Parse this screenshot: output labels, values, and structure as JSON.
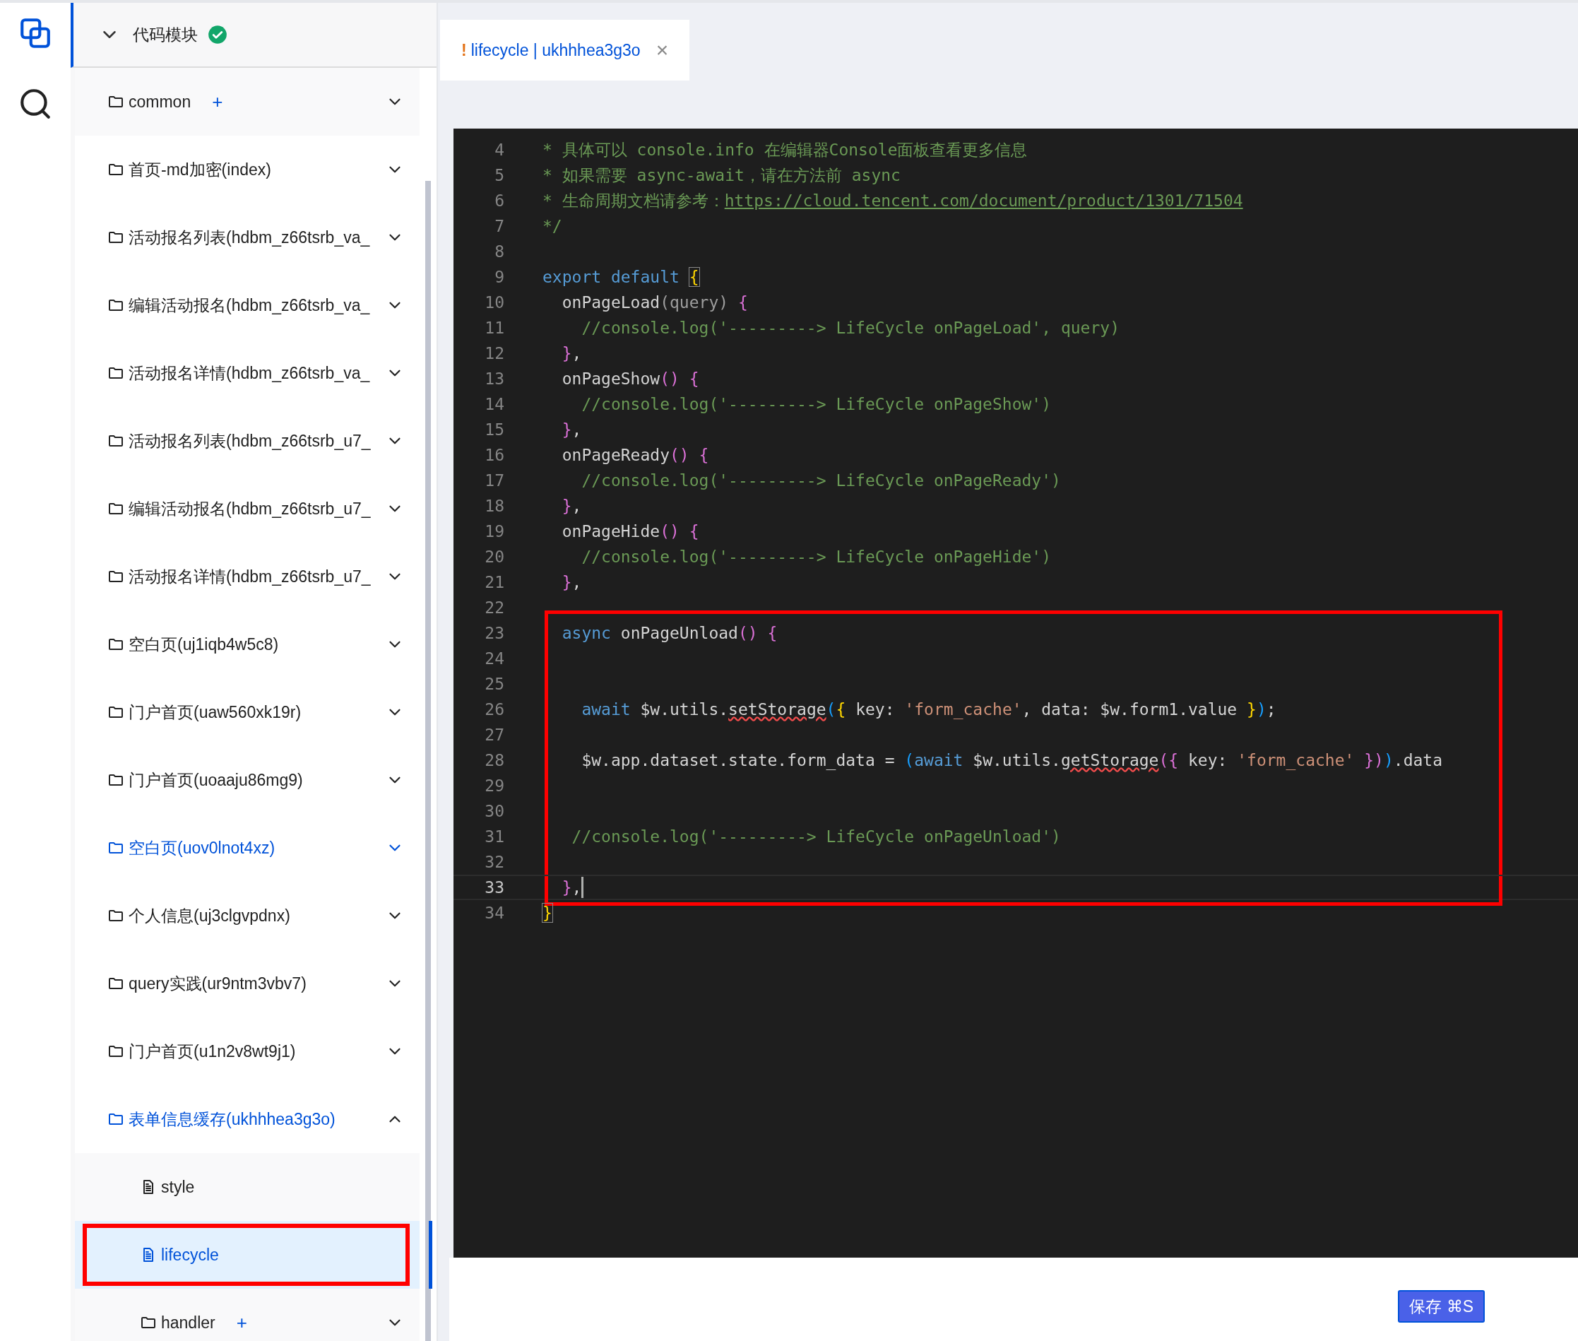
{
  "activity_bar": {
    "items": [
      {
        "kind": "pages",
        "selected": true
      },
      {
        "kind": "search",
        "selected": false
      }
    ]
  },
  "tree": {
    "label": "代码模块",
    "expanded": true,
    "status_ok": true,
    "children": [
      {
        "kind": "folder",
        "label": "common",
        "add": "+",
        "expanded": false,
        "selected": false,
        "shaded": true
      },
      {
        "kind": "folder",
        "label": "首页-md加密(index)",
        "expanded": false,
        "selected": false
      },
      {
        "kind": "folder",
        "label": "活动报名列表(hdbm_z66tsrb_va_",
        "expanded": false,
        "selected": false
      },
      {
        "kind": "folder",
        "label": "编辑活动报名(hdbm_z66tsrb_va_",
        "expanded": false,
        "selected": false
      },
      {
        "kind": "folder",
        "label": "活动报名详情(hdbm_z66tsrb_va_",
        "expanded": false,
        "selected": false
      },
      {
        "kind": "folder",
        "label": "活动报名列表(hdbm_z66tsrb_u7_",
        "expanded": false,
        "selected": false
      },
      {
        "kind": "folder",
        "label": "编辑活动报名(hdbm_z66tsrb_u7_",
        "expanded": false,
        "selected": false
      },
      {
        "kind": "folder",
        "label": "活动报名详情(hdbm_z66tsrb_u7_",
        "expanded": false,
        "selected": false
      },
      {
        "kind": "folder",
        "label": "空白页(uj1iqb4w5c8)",
        "expanded": false,
        "selected": false
      },
      {
        "kind": "folder",
        "label": "门户首页(uaw560xk19r)",
        "expanded": false,
        "selected": false
      },
      {
        "kind": "folder",
        "label": "门户首页(uoaaju86mg9)",
        "expanded": false,
        "selected": false
      },
      {
        "kind": "folder",
        "label": "空白页(uov0lnot4xz)",
        "expanded": false,
        "selected": true
      },
      {
        "kind": "folder",
        "label": "个人信息(uj3clgvpdnx)",
        "expanded": false,
        "selected": false
      },
      {
        "kind": "folder",
        "label": "query实践(ur9ntm3vbv7)",
        "expanded": false,
        "selected": false
      },
      {
        "kind": "folder",
        "label": "门户首页(u1n2v8wt9j1)",
        "expanded": false,
        "selected": false
      },
      {
        "kind": "folder",
        "label": "表单信息缓存(ukhhhea3g3o)",
        "expanded": true,
        "selected": true,
        "children": [
          {
            "kind": "file",
            "label": "style",
            "selected": false,
            "annotated": false
          },
          {
            "kind": "file",
            "label": "lifecycle",
            "selected": true,
            "annotated": true
          },
          {
            "kind": "folder",
            "label": "handler",
            "add": "+",
            "expanded": false,
            "selected": false
          }
        ]
      }
    ]
  },
  "tabs": [
    {
      "warning": "!",
      "label": "lifecycle | ukhhhea3g3o",
      "close": "×",
      "selected": true
    }
  ],
  "editor": {
    "lines": [
      {
        "number": "4",
        "current": false,
        "boxed": false,
        "tokens": [
          {
            "kind": "comment",
            "text": "* 具体可以 console.info 在编辑器Console面板查看更多信息"
          }
        ]
      },
      {
        "number": "5",
        "current": false,
        "boxed": false,
        "tokens": [
          {
            "kind": "comment",
            "text": "* 如果需要 async-await，请在方法前 async"
          }
        ]
      },
      {
        "number": "6",
        "current": false,
        "boxed": false,
        "tokens": [
          {
            "kind": "comment",
            "text": "* 生命周期文档请参考："
          },
          {
            "kind": "link",
            "text": "https://cloud.tencent.com/document/product/1301/71504"
          }
        ]
      },
      {
        "number": "7",
        "current": false,
        "boxed": false,
        "tokens": [
          {
            "kind": "comment",
            "text": "*/"
          }
        ]
      },
      {
        "number": "8",
        "current": false,
        "boxed": false
      },
      {
        "number": "9",
        "current": false,
        "boxed": false,
        "tokens": [
          {
            "kind": "keyword",
            "text": "export default "
          },
          {
            "kind": "brace_match",
            "text": "{"
          }
        ]
      },
      {
        "number": "10",
        "current": false,
        "boxed": false,
        "tokens": [
          {
            "kind": "plain",
            "text": "  onPageLoad"
          },
          {
            "kind": "dim",
            "text": "(query)"
          },
          {
            "kind": "pink",
            "text": " {"
          }
        ]
      },
      {
        "number": "11",
        "current": false,
        "boxed": false,
        "tokens": [
          {
            "kind": "comment",
            "text": "    //console.log('---------> LifeCycle onPageLoad', query)"
          }
        ]
      },
      {
        "number": "12",
        "current": false,
        "boxed": false,
        "tokens": [
          {
            "kind": "pink",
            "text": "  }"
          },
          {
            "kind": "plain",
            "text": ","
          }
        ]
      },
      {
        "number": "13",
        "current": false,
        "boxed": false,
        "tokens": [
          {
            "kind": "plain",
            "text": "  onPageShow"
          },
          {
            "kind": "pink",
            "text": "() {"
          }
        ]
      },
      {
        "number": "14",
        "current": false,
        "boxed": false,
        "tokens": [
          {
            "kind": "comment",
            "text": "    //console.log('---------> LifeCycle onPageShow')"
          }
        ]
      },
      {
        "number": "15",
        "current": false,
        "boxed": false,
        "tokens": [
          {
            "kind": "pink",
            "text": "  }"
          },
          {
            "kind": "plain",
            "text": ","
          }
        ]
      },
      {
        "number": "16",
        "current": false,
        "boxed": false,
        "tokens": [
          {
            "kind": "plain",
            "text": "  onPageReady"
          },
          {
            "kind": "pink",
            "text": "() {"
          }
        ]
      },
      {
        "number": "17",
        "current": false,
        "boxed": false,
        "tokens": [
          {
            "kind": "comment",
            "text": "    //console.log('---------> LifeCycle onPageReady')"
          }
        ]
      },
      {
        "number": "18",
        "current": false,
        "boxed": false,
        "tokens": [
          {
            "kind": "pink",
            "text": "  }"
          },
          {
            "kind": "plain",
            "text": ","
          }
        ]
      },
      {
        "number": "19",
        "current": false,
        "boxed": false,
        "tokens": [
          {
            "kind": "plain",
            "text": "  onPageHide"
          },
          {
            "kind": "pink",
            "text": "() {"
          }
        ]
      },
      {
        "number": "20",
        "current": false,
        "boxed": false,
        "tokens": [
          {
            "kind": "comment",
            "text": "    //console.log('---------> LifeCycle onPageHide')"
          }
        ]
      },
      {
        "number": "21",
        "current": false,
        "boxed": false,
        "tokens": [
          {
            "kind": "pink",
            "text": "  }"
          },
          {
            "kind": "plain",
            "text": ","
          }
        ]
      },
      {
        "number": "22",
        "current": false,
        "boxed": false
      },
      {
        "number": "23",
        "current": false,
        "boxed": true,
        "tokens": [
          {
            "kind": "keyword",
            "text": "  async"
          },
          {
            "kind": "plain",
            "text": " onPageUnload"
          },
          {
            "kind": "pink",
            "text": "() {"
          }
        ]
      },
      {
        "number": "24",
        "current": false,
        "boxed": true
      },
      {
        "number": "25",
        "current": false,
        "boxed": true
      },
      {
        "number": "26",
        "current": false,
        "boxed": true,
        "tokens": [
          {
            "kind": "keyword",
            "text": "    await"
          },
          {
            "kind": "plain",
            "text": " $w.utils."
          },
          {
            "kind": "warn",
            "text": "setStorage"
          },
          {
            "kind": "blue",
            "text": "("
          },
          {
            "kind": "yellow",
            "text": "{"
          },
          {
            "kind": "plain",
            "text": " key: "
          },
          {
            "kind": "string",
            "text": "'form_cache'"
          },
          {
            "kind": "plain",
            "text": ", data: $w.form1.value "
          },
          {
            "kind": "yellow",
            "text": "}"
          },
          {
            "kind": "blue",
            "text": ")"
          },
          {
            "kind": "plain",
            "text": ";"
          }
        ]
      },
      {
        "number": "27",
        "current": false,
        "boxed": true
      },
      {
        "number": "28",
        "current": false,
        "boxed": true,
        "tokens": [
          {
            "kind": "plain",
            "text": "    $w.app.dataset.state.form_data = "
          },
          {
            "kind": "blue",
            "text": "("
          },
          {
            "kind": "keyword",
            "text": "await"
          },
          {
            "kind": "plain",
            "text": " $w.utils."
          },
          {
            "kind": "warn",
            "text": "getStorage"
          },
          {
            "kind": "pink",
            "text": "({"
          },
          {
            "kind": "plain",
            "text": " key: "
          },
          {
            "kind": "string",
            "text": "'form_cache'"
          },
          {
            "kind": "pink",
            "text": " })"
          },
          {
            "kind": "blue",
            "text": ")"
          },
          {
            "kind": "plain",
            "text": ".data"
          }
        ]
      },
      {
        "number": "29",
        "current": false,
        "boxed": true
      },
      {
        "number": "30",
        "current": false,
        "boxed": true
      },
      {
        "number": "31",
        "current": false,
        "boxed": true,
        "tokens": [
          {
            "kind": "comment",
            "text": "   //console.log('---------> LifeCycle onPageUnload')"
          }
        ]
      },
      {
        "number": "32",
        "current": false,
        "boxed": true
      },
      {
        "number": "33",
        "current": true,
        "boxed": true,
        "tokens": [
          {
            "kind": "pink",
            "text": "  }"
          },
          {
            "kind": "plain",
            "text": ","
          }
        ]
      },
      {
        "number": "34",
        "current": false,
        "boxed": false,
        "tokens": [
          {
            "kind": "brace_match",
            "text": "}"
          }
        ]
      }
    ]
  },
  "save_button": {
    "label": "保存 ⌘S"
  }
}
